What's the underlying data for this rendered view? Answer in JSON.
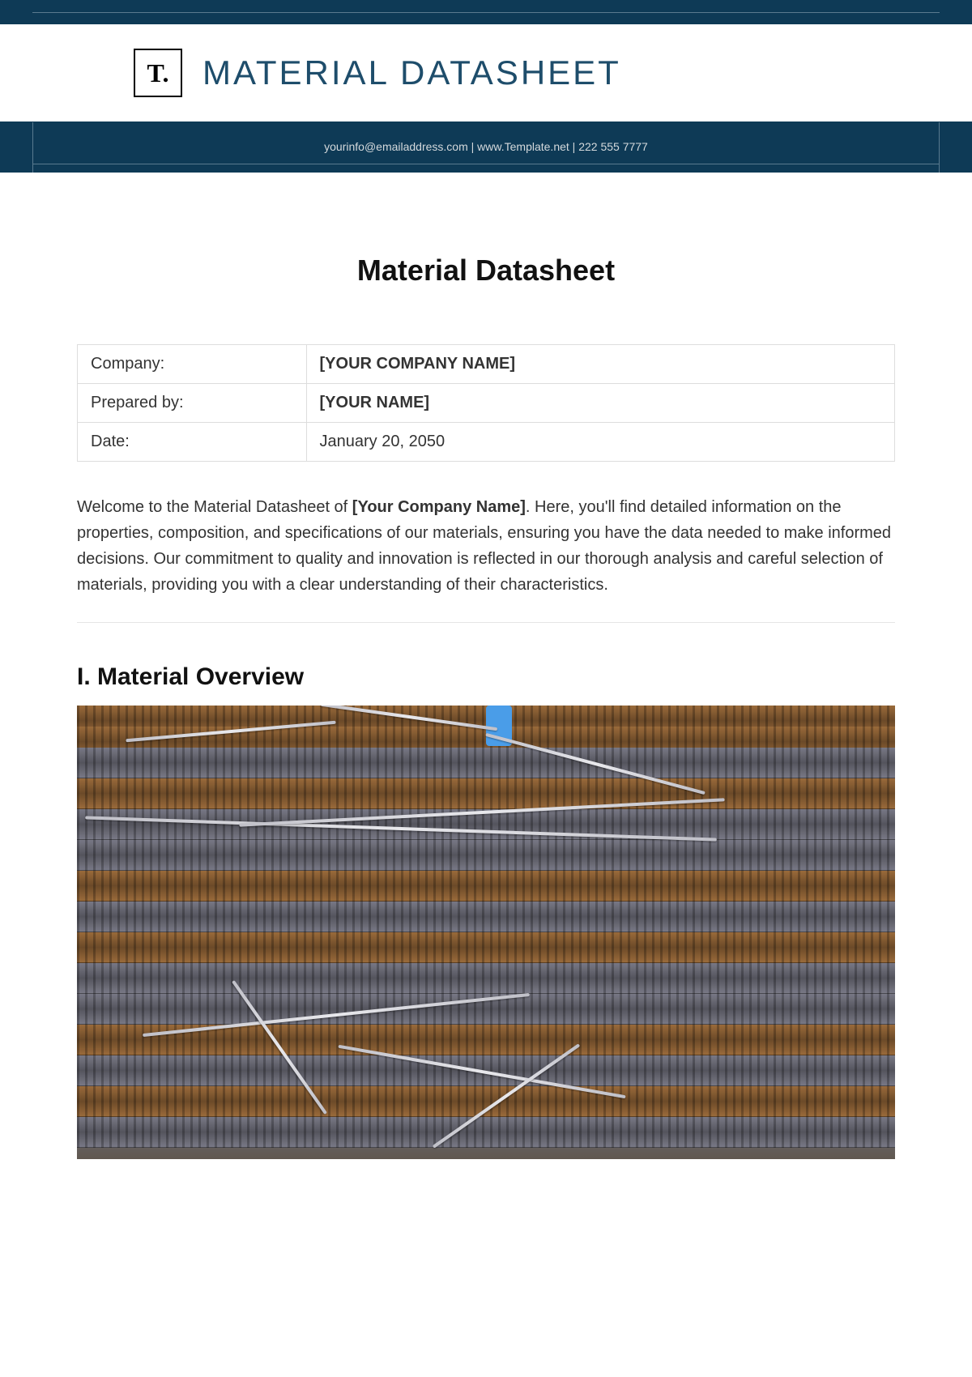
{
  "header": {
    "logo_text": "T.",
    "title": "MATERIAL DATASHEET",
    "contact_line": "yourinfo@emailaddress.com  |  www.Template.net  |  222 555 7777"
  },
  "document": {
    "title": "Material Datasheet"
  },
  "info": {
    "rows": [
      {
        "label": "Company:",
        "value": "[YOUR COMPANY NAME]",
        "bold": true
      },
      {
        "label": "Prepared by:",
        "value": "[YOUR NAME]",
        "bold": true
      },
      {
        "label": "Date:",
        "value": "January 20, 2050",
        "bold": false
      }
    ]
  },
  "intro": {
    "pre": "Welcome to the Material Datasheet of ",
    "placeholder": "[Your Company Name]",
    "post": ". Here, you'll find detailed information on the properties, composition, and specifications of our materials, ensuring you have the data needed to make informed decisions. Our commitment to quality and innovation is reflected in our thorough analysis and careful selection of materials, providing you with a clear understanding of their characteristics."
  },
  "section1": {
    "title": "I. Material Overview",
    "image_alt": "Stacked steel rebar with wire ties"
  }
}
